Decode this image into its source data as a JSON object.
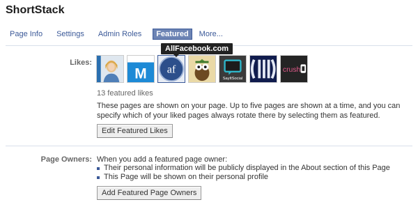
{
  "app": {
    "title": "ShortStack"
  },
  "tabs": [
    {
      "label": "Page Info",
      "active": false
    },
    {
      "label": "Settings",
      "active": false
    },
    {
      "label": "Admin Roles",
      "active": false
    },
    {
      "label": "Featured",
      "active": true
    },
    {
      "label": "More...",
      "active": false
    }
  ],
  "likes": {
    "label": "Likes:",
    "tooltip": "AllFacebook.com",
    "thumbnails": [
      {
        "name": "person-photo"
      },
      {
        "name": "m-logo",
        "text": "M"
      },
      {
        "name": "af-logo",
        "text": "af"
      },
      {
        "name": "cartoon-mascot"
      },
      {
        "name": "saysocial-logo",
        "text": "SayItSocial"
      },
      {
        "name": "blue-stripes-logo"
      },
      {
        "name": "crush-logo",
        "text": "crush"
      }
    ],
    "count_text": "13 featured likes",
    "description": "These pages are shown on your page. Up to five pages are shown at a time, and you can specify which of your liked pages always rotate there by selecting them as featured.",
    "edit_button": "Edit Featured Likes"
  },
  "owners": {
    "label": "Page Owners:",
    "intro": "When you add a featured page owner:",
    "items": [
      "Their personal information will be publicly displayed in the About section of this Page",
      "This Page will be shown on their personal profile"
    ],
    "add_button": "Add Featured Page Owners"
  },
  "colors": {
    "link": "#3b5998",
    "active_tab": "#6d84b4",
    "divider": "#d8dfea"
  }
}
